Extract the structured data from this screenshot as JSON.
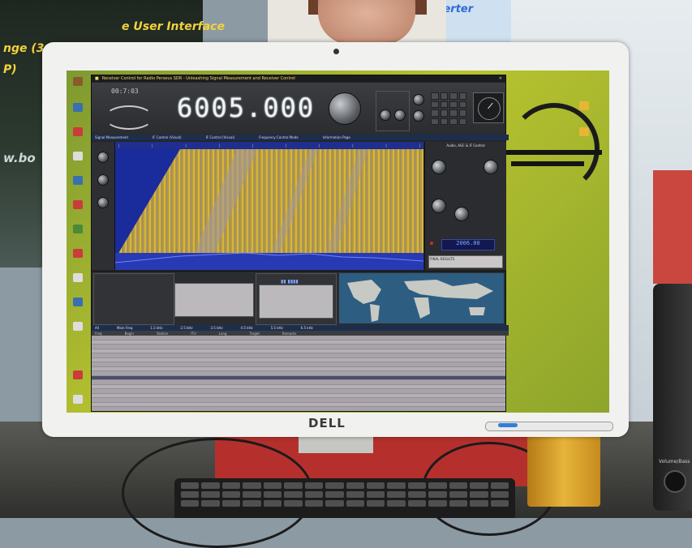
{
  "scene": {
    "poster_text_left": "e User Interface",
    "poster_text_left2": "nge (3",
    "poster_text_left3": "P)",
    "poster_text_left4": "w.bo",
    "poster_text_right": "verter",
    "speaker_label": "Volume/Bass"
  },
  "monitor": {
    "brand": "DELL"
  },
  "app": {
    "title": "Receiver Control for Radio Perseus SDR - Unleashing Signal Measurement and Receiver Control",
    "frequency": "6005.000",
    "logo_digits": "00:7:03",
    "band_labels": [
      "160m",
      "80m",
      "60m",
      "49m",
      "41m",
      "31m",
      "25m",
      "22m",
      "19m",
      "16m",
      "15m",
      "13m",
      "11m",
      "10m"
    ],
    "tabs": [
      "Signal Measurement",
      "IF Control (Visual)",
      "IF Control (Visual)",
      "Frequency Control Mode",
      "Information Page"
    ],
    "right_panel_title": "Audio, AGC & IF Control",
    "right_panel_bluebox": "2006.00",
    "right_panel_info": "FINAL RESULTS",
    "table_tabs": [
      "All",
      "Main Freq",
      "1.5 kHz",
      "2.5 kHz",
      "3.5 kHz",
      "4.5 kHz",
      "5.5 kHz",
      "6.5 kHz"
    ],
    "table_columns": [
      "Freq",
      "Begin",
      "Station",
      "ITU",
      "Lang",
      "Target",
      "Remarks"
    ]
  }
}
